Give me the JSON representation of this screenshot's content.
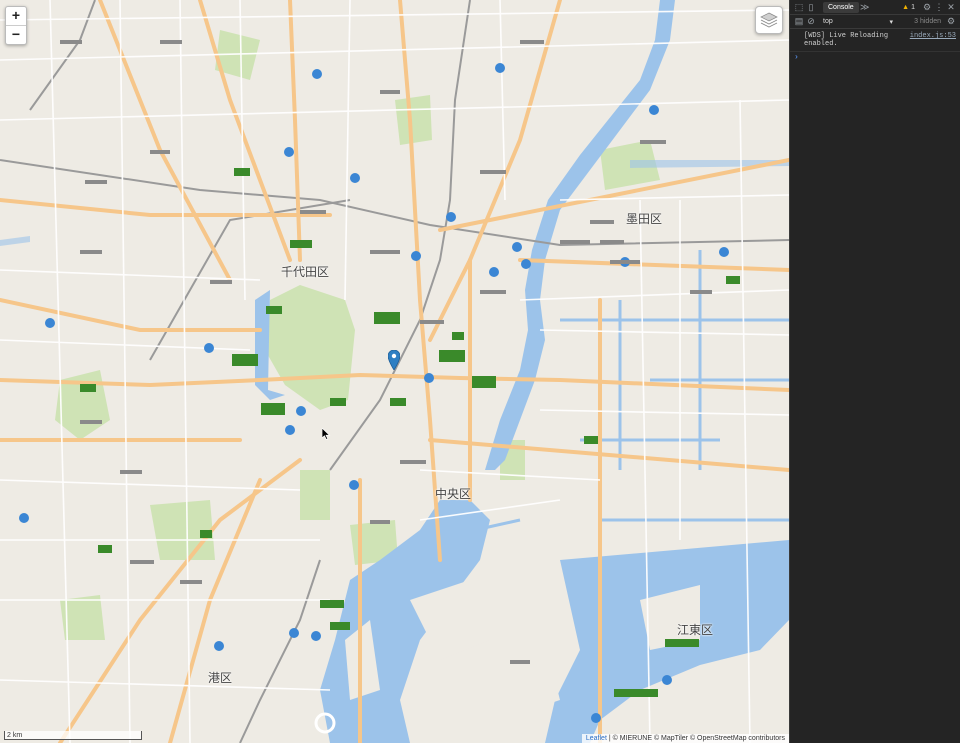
{
  "map": {
    "zoom_in_label": "+",
    "zoom_out_label": "−",
    "scale_label": "2 km",
    "attribution": {
      "leaflet": "Leaflet",
      "rest": " | © MIERUNE © MapTiler © OpenStreetMap contributors"
    },
    "areas": [
      {
        "name": "千代田区"
      },
      {
        "name": "墨田区"
      },
      {
        "name": "中央区"
      },
      {
        "name": "江東区"
      },
      {
        "name": "港区"
      }
    ],
    "colors": {
      "water": "#9cc3ea",
      "land": "#eeebe4",
      "park": "#cfe3b5",
      "major_road": "#f6c68a",
      "route_badge": "#3b86d4",
      "marker": "#2e7fc3"
    }
  },
  "devtools": {
    "tab_console": "Console",
    "more": "≫",
    "warning_count": "1",
    "context": "top",
    "hidden_count": "3 hidden",
    "logs": [
      {
        "message": "[WDS] Live Reloading enabled.",
        "source": "index.js:53"
      }
    ],
    "prompt": "›"
  }
}
